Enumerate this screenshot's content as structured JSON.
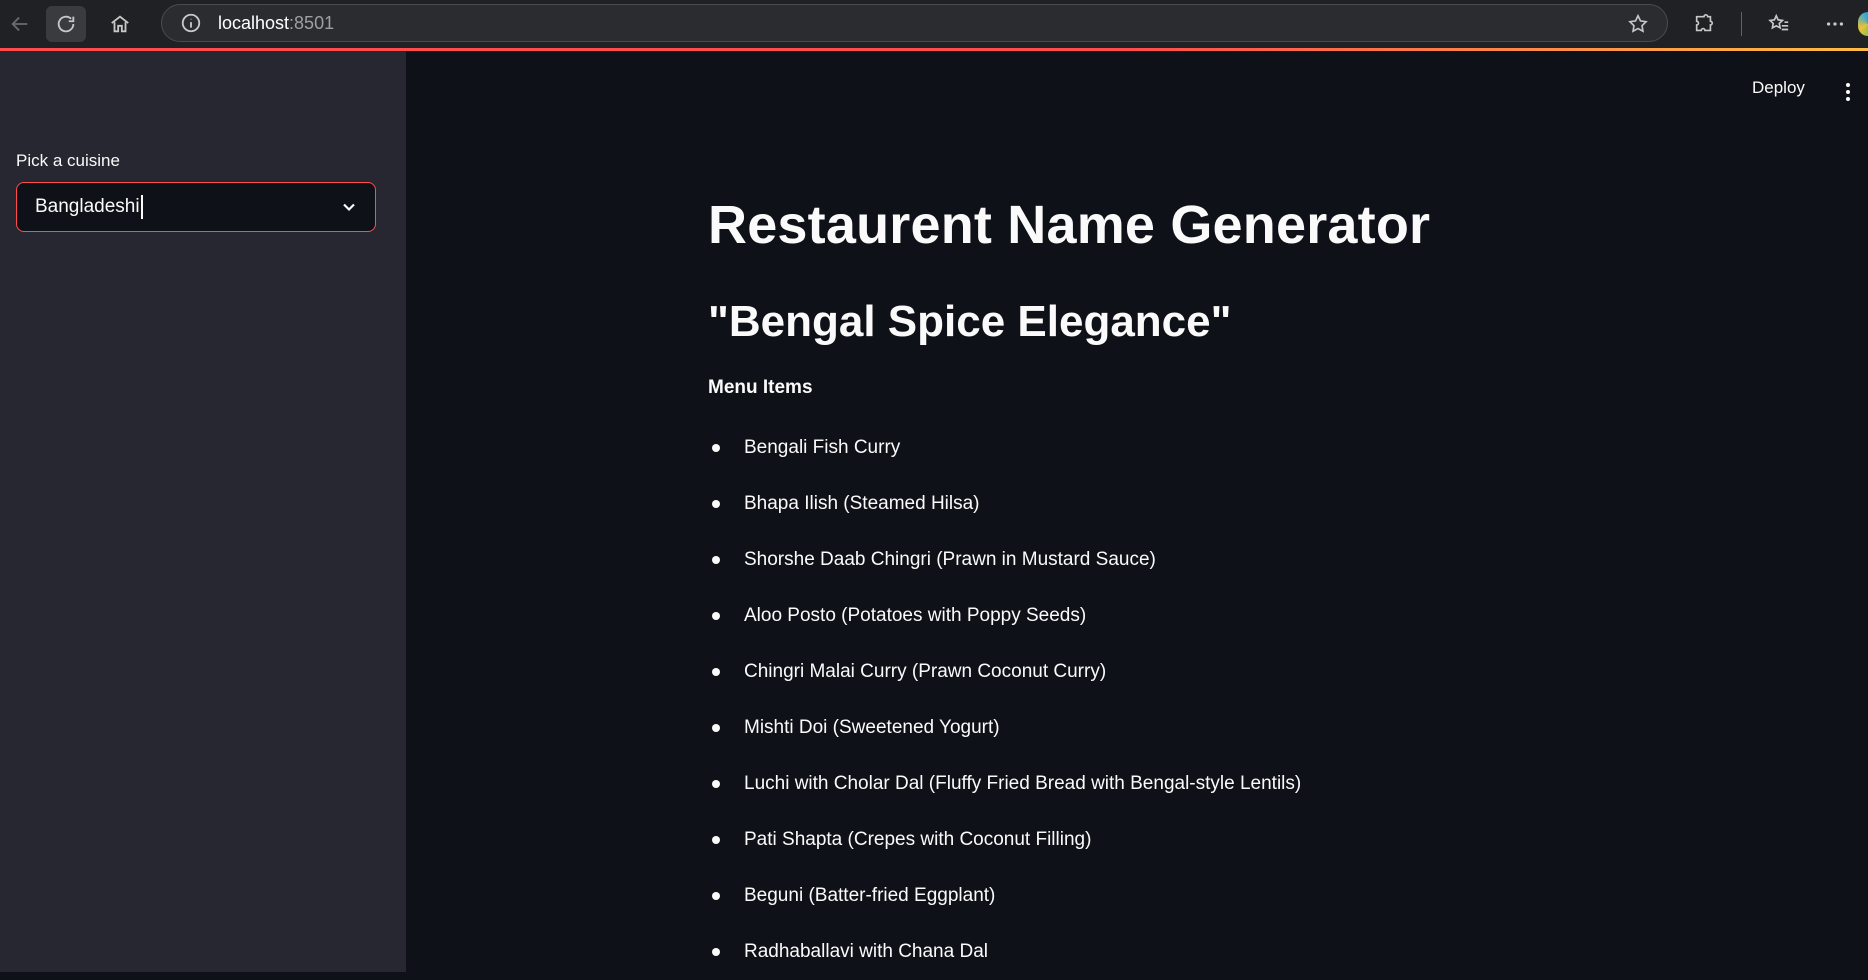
{
  "browser": {
    "url_host": "localhost",
    "url_port": ":8501"
  },
  "sidebar": {
    "label": "Pick a cuisine",
    "selected_value": "Bangladeshi"
  },
  "header": {
    "deploy_label": "Deploy"
  },
  "main": {
    "title": "Restaurent Name Generator",
    "restaurant_name": "\"Bengal Spice Elegance\"",
    "menu_heading": "Menu Items",
    "menu_items": [
      "Bengali Fish Curry",
      "Bhapa Ilish (Steamed Hilsa)",
      "Shorshe Daab Chingri (Prawn in Mustard Sauce)",
      "Aloo Posto (Potatoes with Poppy Seeds)",
      "Chingri Malai Curry (Prawn Coconut Curry)",
      "Mishti Doi (Sweetened Yogurt)",
      "Luchi with Cholar Dal (Fluffy Fried Bread with Bengal-style Lentils)",
      "Pati Shapta (Crepes with Coconut Filling)",
      "Beguni (Batter-fried Eggplant)",
      "Radhaballavi with Chana Dal"
    ]
  },
  "colors": {
    "accent": "#ff4b4b",
    "background": "#0e1117",
    "sidebar": "#262730"
  }
}
